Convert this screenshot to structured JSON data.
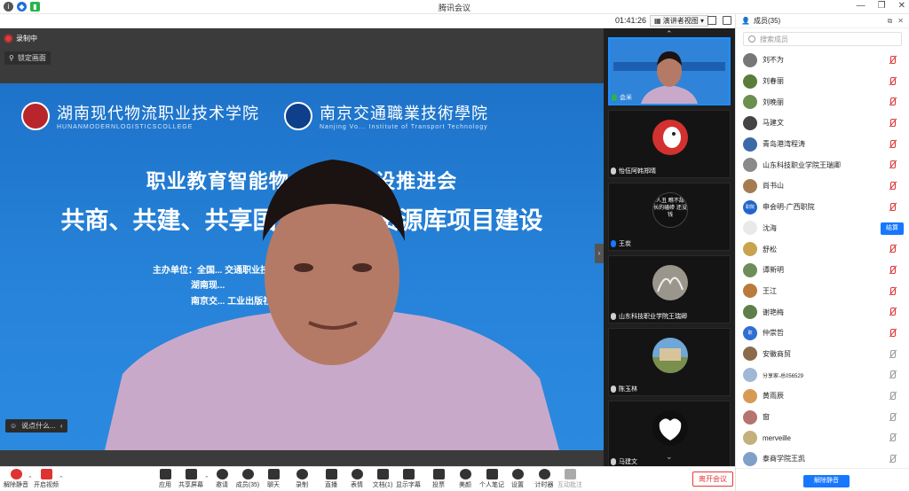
{
  "window": {
    "title": "腾讯会议",
    "minimize": "—",
    "restore": "❐",
    "close": "✕"
  },
  "topbar": {
    "timer": "01:41:26",
    "view_label": "演讲者视图",
    "members_label": "成员(35)"
  },
  "main": {
    "recording_label": "录制中",
    "lock_label": "锁定画面",
    "speaking_label": "说点什么...",
    "slide": {
      "school1": "湖南现代物流职业技术学院",
      "school1_en": "HUNANMODERNLOGISTICSCOLLEGE",
      "school2": "南京交通職業技術學院",
      "school2_en": "Nanjing Vo... Institute of Transport Technology",
      "title1": "职业教育智能物... 源库建设推进会",
      "title2": "共商、共建、共享国... 业教学资源库项目建设",
      "org1": "主办单位：全国... 交通职业技术学院",
      "org2": "湖南现...",
      "org3": "南京交... 工业出版社"
    }
  },
  "strip": {
    "tiles": [
      {
        "name": "会米"
      },
      {
        "name": "怡伍阿韩郑晴"
      },
      {
        "name": "王炭",
        "avatar_text": "人丑 瞧不甜 长的磕碜 还没钱"
      },
      {
        "name": "山东科技职业学院王瑞卿"
      },
      {
        "name": "陈玉林"
      },
      {
        "name": "马建文"
      }
    ]
  },
  "panel": {
    "search_placeholder": "搜索成员",
    "mute_button": "解除静音",
    "action_button": "结算",
    "members": [
      {
        "name": "刘不为",
        "color": "#777777"
      },
      {
        "name": "刘春丽",
        "color": "#5a7d3a"
      },
      {
        "name": "刘晚丽",
        "color": "#6b8f4e"
      },
      {
        "name": "马建文",
        "color": "#444444"
      },
      {
        "name": "青岛港湾程涛",
        "color": "#3c6aa6"
      },
      {
        "name": "山东科技职业学院王瑞卿",
        "color": "#8a8a8a"
      },
      {
        "name": "尚书山",
        "color": "#a57c52"
      },
      {
        "name": "申会明-广西职院",
        "color": "#2266cc",
        "initials": "职院"
      },
      {
        "name": "沈海",
        "color": "#e9e9e9"
      },
      {
        "name": "舒松",
        "color": "#c9a34e"
      },
      {
        "name": "谭新明",
        "color": "#6f8d5a"
      },
      {
        "name": "王江",
        "color": "#b97a3b"
      },
      {
        "name": "谢艳梅",
        "color": "#5e7f49"
      },
      {
        "name": "仲崇哲",
        "color": "#2f6fd1",
        "initials": "职"
      },
      {
        "name": "安徽商贸",
        "color": "#8b6b4a"
      },
      {
        "name": "分享家-总056529",
        "color": "#a0b7d6"
      },
      {
        "name": "黄雨辰",
        "color": "#d79a55"
      },
      {
        "name": "窗",
        "color": "#b57470"
      },
      {
        "name": "merveille",
        "color": "#c4b07c"
      },
      {
        "name": "泰商学院王凯",
        "color": "#7fa0c9"
      }
    ]
  },
  "toolbar": {
    "items": [
      {
        "label": "解除静音"
      },
      {
        "label": "开启视频"
      },
      {
        "label": "应用"
      },
      {
        "label": "共享屏幕"
      },
      {
        "label": "邀请"
      },
      {
        "label": "成员(35)"
      },
      {
        "label": "聊天"
      },
      {
        "label": "录制"
      },
      {
        "label": "直播"
      },
      {
        "label": "表情"
      },
      {
        "label": "文档(1)"
      },
      {
        "label": "显示字幕"
      },
      {
        "label": "投票"
      },
      {
        "label": "美颜"
      },
      {
        "label": "个人笔记"
      },
      {
        "label": "设置"
      },
      {
        "label": "计时器"
      },
      {
        "label": "互动批注"
      }
    ],
    "leave_label": "离开会议"
  }
}
